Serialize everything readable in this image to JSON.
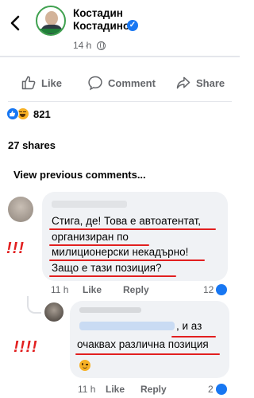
{
  "header": {
    "back_icon": "chevron-left-icon",
    "page_name_line1": "Костадин",
    "page_name_line2": "Костадинов",
    "verified_icon": "verified-badge-icon",
    "time": "14 h",
    "separator": "·",
    "privacy_icon": "globe-icon"
  },
  "actions": {
    "like": "Like",
    "comment": "Comment",
    "share": "Share"
  },
  "reactions": {
    "icons": [
      "like-reaction-icon",
      "haha-reaction-icon"
    ],
    "count": "821"
  },
  "shares": "27 shares",
  "view_previous": "View previous comments...",
  "comments": [
    {
      "lines": [
        "Стига, де! Това е автоатентат,",
        "организиран по",
        "милиционерски некадърно!",
        "Защо е тази позиция?"
      ],
      "time": "11 h",
      "like": "Like",
      "reply": "Reply",
      "reaction_count": "12",
      "annotation": "!!!"
    },
    {
      "line1": ", и аз",
      "line2": "очаквах различна позиция",
      "emoji": "wink-emoji-icon",
      "time": "11 h",
      "like": "Like",
      "reply": "Reply",
      "reaction_count": "2",
      "annotation": "!!!!"
    }
  ],
  "colors": {
    "accent": "#1877f2",
    "annotation": "#e21f1f",
    "bubble": "#f0f2f5",
    "muted": "#65676b"
  }
}
